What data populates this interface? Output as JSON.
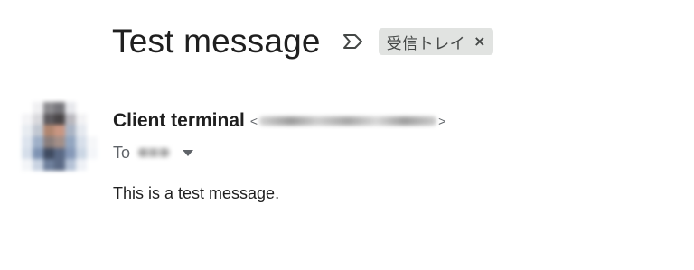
{
  "email": {
    "subject": "Test message",
    "label": {
      "text": "受信トレイ",
      "close_glyph": "×"
    },
    "importance_icon": "importance-marker-icon",
    "sender": {
      "name": "Client terminal",
      "email_open": "<",
      "email_close": ">"
    },
    "recipient": {
      "prefix": "To",
      "toggle_icon": "caret-down-icon"
    },
    "body": "This is a test message."
  },
  "colors": {
    "text_primary": "#1f1f1f",
    "text_secondary": "#5f6368",
    "chip_bg": "#e1e3e1"
  }
}
